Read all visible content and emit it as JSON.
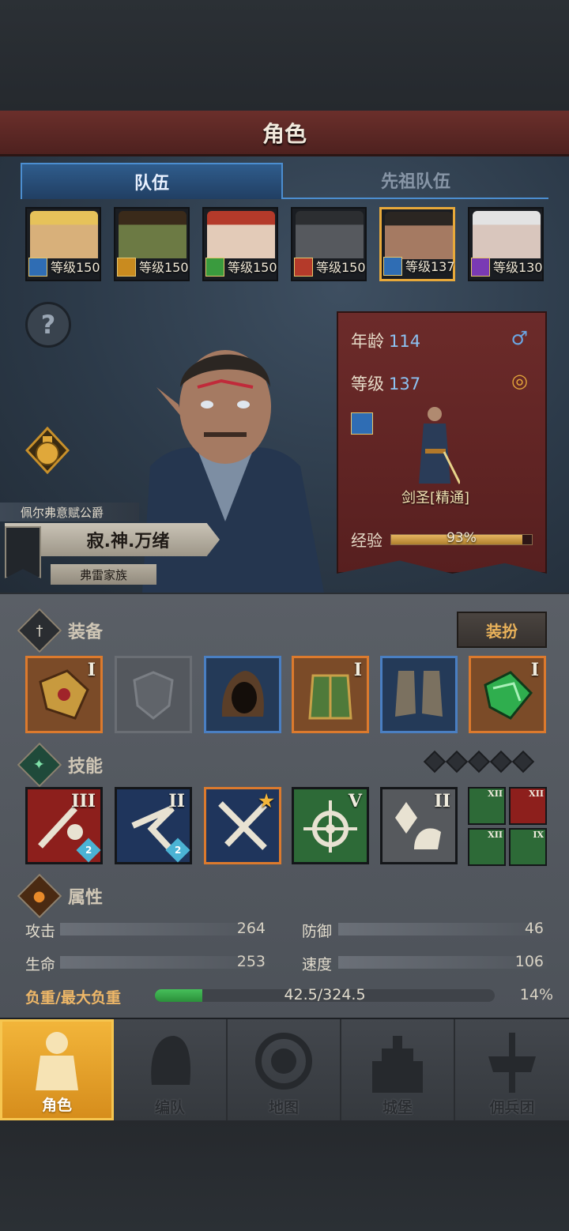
{
  "header": {
    "title": "角色"
  },
  "tabs": [
    {
      "label": "队伍"
    },
    {
      "label": "先祖队伍"
    }
  ],
  "party": [
    {
      "level": "等级150",
      "class_color": "#2f6db4",
      "face": "#d8b07a",
      "hair": "#e6c25a"
    },
    {
      "level": "等级150",
      "class_color": "#c98b1f",
      "face": "#6c7a44",
      "hair": "#3a2a1a"
    },
    {
      "level": "等级150",
      "class_color": "#3a9b3e",
      "face": "#e3cbb8",
      "hair": "#b43a2a"
    },
    {
      "level": "等级150",
      "class_color": "#b43a2a",
      "face": "#56595e",
      "hair": "#2c2e31"
    },
    {
      "level": "等级137",
      "class_color": "#2f6db4",
      "face": "#a57a62",
      "hair": "#2b2622"
    },
    {
      "level": "等级130",
      "class_color": "#7a3ab4",
      "face": "#d9c6bd",
      "hair": "#e3e3e3"
    }
  ],
  "character": {
    "title": "佩尔弗意赋公爵",
    "name": "寂.神.万绪",
    "family": "弗雷家族",
    "age_label": "年龄",
    "age": "114",
    "level_label": "等级",
    "level": "137",
    "class_name": "剑圣[精通]",
    "exp_label": "经验",
    "exp_text": "93%",
    "exp_fraction": 0.93
  },
  "equipment": {
    "title": "装备",
    "dress_button": "装扮",
    "slots": [
      {
        "roman": "I",
        "rarity": "orange",
        "icon": "shoulder-armor-icon"
      },
      {
        "roman": "",
        "rarity": "empty",
        "icon": "empty-shield-icon"
      },
      {
        "roman": "",
        "rarity": "blue",
        "icon": "hood-icon"
      },
      {
        "roman": "I",
        "rarity": "orange",
        "icon": "chest-armor-icon"
      },
      {
        "roman": "",
        "rarity": "blue",
        "icon": "boots-icon"
      },
      {
        "roman": "I",
        "rarity": "orange",
        "icon": "gem-gauntlet-icon"
      }
    ]
  },
  "skills": {
    "title": "技能",
    "list": [
      {
        "roman": "III",
        "badge": "2",
        "style": "red"
      },
      {
        "roman": "II",
        "badge": "2",
        "style": "navy"
      },
      {
        "roman": "",
        "badge": "",
        "style": "navyo"
      },
      {
        "roman": "V",
        "badge": "",
        "style": "green"
      },
      {
        "roman": "II",
        "badge": "",
        "style": "gray"
      }
    ],
    "passives": [
      {
        "roman": "XII",
        "color": "#2d6a37"
      },
      {
        "roman": "XII",
        "color": "#8d1f1c"
      },
      {
        "roman": "XII",
        "color": "#2d6a37"
      },
      {
        "roman": "IX",
        "color": "#2d6a37"
      }
    ]
  },
  "attributes": {
    "title": "属性",
    "attack_label": "攻击",
    "attack": "264",
    "defense_label": "防御",
    "defense": "46",
    "hp_label": "生命",
    "hp": "253",
    "speed_label": "速度",
    "speed": "106",
    "load_label": "负重/最大负重",
    "load_text": "42.5/324.5",
    "load_pct": "14%",
    "load_fraction": 0.14
  },
  "nav": [
    {
      "label": "角色"
    },
    {
      "label": "编队"
    },
    {
      "label": "地图"
    },
    {
      "label": "城堡"
    },
    {
      "label": "佣兵团"
    }
  ]
}
